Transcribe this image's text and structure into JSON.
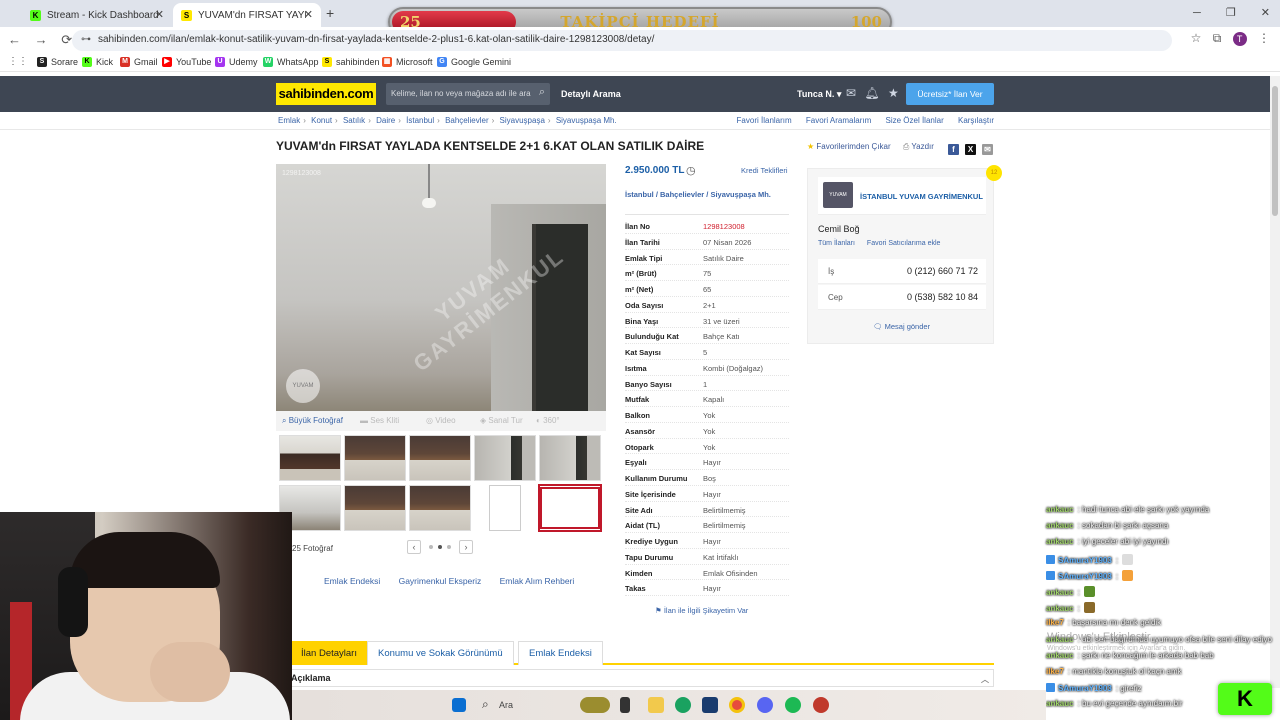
{
  "browser": {
    "tabs": [
      {
        "label": "Stream - Kick Dashboard",
        "favicon": "kick-icon"
      },
      {
        "label": "YUVAM'dn FIRSAT YAYLADA KE",
        "favicon": "sahibinden-icon"
      }
    ],
    "url": "sahibinden.com/ilan/emlak-konut-satilik-yuvam-dn-firsat-yaylada-kentselde-2-plus1-6.kat-olan-satilik-daire-1298123008/detay/",
    "bookmarks": [
      "Sorare",
      "Kick",
      "Gmail",
      "YouTube",
      "Udemy",
      "WhatsApp",
      "sahibinden",
      "Microsoft",
      "Google Gemini"
    ],
    "profile_initial": "T"
  },
  "goal": {
    "current": "25",
    "title": "TAKİPÇİ HEDEFİ",
    "target": "100",
    "progress_fraction": 0.25
  },
  "site": {
    "logo": "sahibinden.com",
    "search_placeholder": "Kelime, ilan no veya mağaza adı ile ara",
    "detailed_search": "Detaylı Arama",
    "user": "Tunca N.",
    "post_button": "Ücretsiz* İlan Ver"
  },
  "breadcrumb": [
    "Emlak",
    "Konut",
    "Satılık",
    "Daire",
    "İstanbul",
    "Bahçelievler",
    "Siyavuşpaşa",
    "Siyavuşpaşa Mh."
  ],
  "top_links": [
    "Favori İlanlarım",
    "Favori Aramalarım",
    "Size Özel İlanlar",
    "Karşılaştır"
  ],
  "listing": {
    "title": "YUVAM'dn FIRSAT YAYLADA KENTSELDE 2+1 6.KAT OLAN SATILIK DAİRE",
    "fav_action": "Favorilerimden Çıkar",
    "print": "Yazdır",
    "price": "2.950.000 TL",
    "credit": "Kredi Teklifleri",
    "location": "İstanbul  /  Bahçelievler  /  Siyavuşpaşa Mh.",
    "photo_toolbar": [
      "Büyük Fotoğraf",
      "Ses Kliti",
      "Video",
      "Sanal Tur",
      "360°"
    ],
    "photo_count": "25 Fotoğraf",
    "watermark": "YUVAM GAYRİMENKUL",
    "under_links": [
      "Emlak Endeksi",
      "Gayrimenkul Eksperiz",
      "Emlak Alım Rehberi"
    ],
    "complaint": "İlan ile İlgili Şikayetim Var",
    "details": [
      {
        "k": "İlan No",
        "v": "1298123008"
      },
      {
        "k": "İlan Tarihi",
        "v": "07 Nisan 2026"
      },
      {
        "k": "Emlak Tipi",
        "v": "Satılık Daire"
      },
      {
        "k": "m² (Brüt)",
        "v": "75"
      },
      {
        "k": "m² (Net)",
        "v": "65"
      },
      {
        "k": "Oda Sayısı",
        "v": "2+1"
      },
      {
        "k": "Bina Yaşı",
        "v": "31 ve üzeri"
      },
      {
        "k": "Bulunduğu Kat",
        "v": "Bahçe Katı"
      },
      {
        "k": "Kat Sayısı",
        "v": "5"
      },
      {
        "k": "Isıtma",
        "v": "Kombi (Doğalgaz)"
      },
      {
        "k": "Banyo Sayısı",
        "v": "1"
      },
      {
        "k": "Mutfak",
        "v": "Kapalı"
      },
      {
        "k": "Balkon",
        "v": "Yok"
      },
      {
        "k": "Asansör",
        "v": "Yok"
      },
      {
        "k": "Otopark",
        "v": "Yok"
      },
      {
        "k": "Eşyalı",
        "v": "Hayır"
      },
      {
        "k": "Kullanım Durumu",
        "v": "Boş"
      },
      {
        "k": "Site İçerisinde",
        "v": "Hayır"
      },
      {
        "k": "Site Adı",
        "v": "Belirtilmemiş"
      },
      {
        "k": "Aidat (TL)",
        "v": "Belirtilmemiş"
      },
      {
        "k": "Krediye Uygun",
        "v": "Hayır"
      },
      {
        "k": "Tapu Durumu",
        "v": "Kat İrtifaklı"
      },
      {
        "k": "Kimden",
        "v": "Emlak Ofisinden"
      },
      {
        "k": "Takas",
        "v": "Hayır"
      }
    ]
  },
  "seller": {
    "store": "İSTANBUL YUVAM GAYRİMENKUL",
    "badge": "12",
    "name": "Cemil Boğ",
    "all_listings": "Tüm İlanları",
    "fav_seller": "Favori Satıcılarıma ekle",
    "work_label": "İş",
    "work_phone": "0 (212) 660 71 72",
    "mobile_label": "Cep",
    "mobile_phone": "0 (538) 582 10 84",
    "message": "Mesaj gönder"
  },
  "bottom_tabs": [
    "İlan Detayları",
    "Konumu ve Sokak Görünümü",
    "Emlak Endeksi"
  ],
  "description_header": "Açıklama",
  "chat": [
    {
      "user": "ankauc",
      "text": ": hadi tunca abi ele şarkı yok yayında"
    },
    {
      "user": "ankauc",
      "text": ": sokadan bi şarkı açsana"
    },
    {
      "user": "ankauc",
      "text": ": iyi geceler abi iyi yayındı"
    },
    {
      "user": "SAmuraY1903",
      "text": ":"
    },
    {
      "user": "SAmuraY1903",
      "text": ":"
    },
    {
      "user": "ankauc",
      "text": ":"
    },
    {
      "user": "ankauc",
      "text": ":"
    },
    {
      "user": "ilke7",
      "text": ": başarsına mı denk geldik"
    },
    {
      "user": "ankauc",
      "text": ": abi sen bağırdında uyumuyo ofsa bile seni dilay ediyo"
    },
    {
      "user": "ankauc",
      "text": ": şarkı ne koncağım le arkada bab bab"
    },
    {
      "user": "ilke7",
      "text": ": mantıkla konuştuk ol kaçn amk"
    },
    {
      "user": "SAmuraY1903",
      "text": ": girefiz"
    },
    {
      "user": "ankauc",
      "text": ": bu evi geçende aynıdaım.bir"
    }
  ],
  "windows_activate": "Windows'u Etkinleştir",
  "windows_activate_sub": "Windows'u etkinleştirmek için Ayarlar'a gidin.",
  "taskbar": {
    "search": "Ara"
  },
  "kick_badge": "K"
}
